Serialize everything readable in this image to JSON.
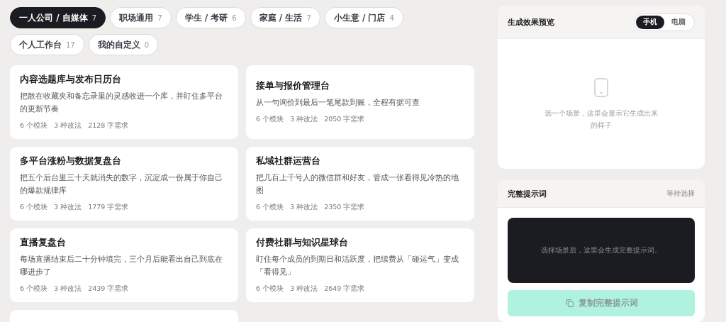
{
  "filters": [
    {
      "label": "一人公司 / 自媒体",
      "count": "7",
      "selected": true
    },
    {
      "label": "职场通用",
      "count": "7",
      "selected": false
    },
    {
      "label": "学生 / 考研",
      "count": "6",
      "selected": false
    },
    {
      "label": "家庭 / 生活",
      "count": "7",
      "selected": false
    },
    {
      "label": "小生意 / 门店",
      "count": "4",
      "selected": false
    },
    {
      "label": "个人工作台",
      "count": "17",
      "selected": false
    },
    {
      "label": "我的自定义",
      "count": "0",
      "selected": false
    }
  ],
  "scenes": [
    {
      "title": "内容选题库与发布日历台",
      "description": "把散在收藏夹和备忘录里的灵感收进一个库，并盯住多平台的更新节奏",
      "modules": "6 个模块",
      "variants": "3 种改法",
      "chars": "2128 字需求"
    },
    {
      "title": "接单与报价管理台",
      "description": "从一句询价到最后一笔尾款到账，全程有据可查",
      "modules": "6 个模块",
      "variants": "3 种改法",
      "chars": "2050 字需求"
    },
    {
      "title": "多平台涨粉与数据复盘台",
      "description": "把五个后台里三十天就消失的数字，沉淀成一份属于你自己的爆款规律库",
      "modules": "6 个模块",
      "variants": "3 种改法",
      "chars": "1779 字需求"
    },
    {
      "title": "私域社群运营台",
      "description": "把几百上千号人的微信群和好友，管成一张看得见冷热的地图",
      "modules": "6 个模块",
      "variants": "3 种改法",
      "chars": "2350 字需求"
    },
    {
      "title": "直播复盘台",
      "description": "每场直播结束后二十分钟填完，三个月后能看出自己到底在哪进步了",
      "modules": "6 个模块",
      "variants": "3 种改法",
      "chars": "2439 字需求"
    },
    {
      "title": "付费社群与知识星球台",
      "description": "盯住每个成员的到期日和活跃度，把续费从「碰运气」变成「看得见」",
      "modules": "6 个模块",
      "variants": "3 种改法",
      "chars": "2649 字需求"
    }
  ],
  "preview": {
    "title": "生成效果预览",
    "devices": [
      {
        "label": "手机",
        "selected": true
      },
      {
        "label": "电脑",
        "selected": false
      }
    ],
    "empty_text": "选一个场景，这里会显示它生成出来的样子"
  },
  "prompt": {
    "title": "完整提示词",
    "status": "等待选择",
    "placeholder": "选择场景后，这里会生成完整提示词。",
    "copy_button": {
      "label": "复制完整提示词",
      "disabled": true
    }
  }
}
